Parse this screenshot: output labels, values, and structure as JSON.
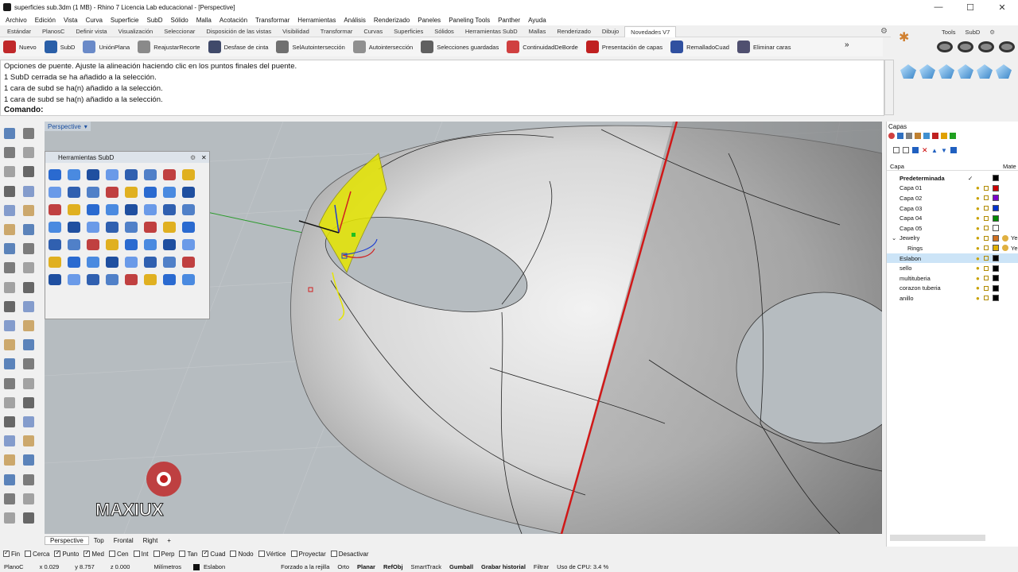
{
  "window": {
    "title": "superficies sub.3dm (1 MB) - Rhino 7 Licencia Lab educacional - [Perspective]"
  },
  "menu": [
    "Archivo",
    "Edición",
    "Vista",
    "Curva",
    "Superficie",
    "SubD",
    "Sólido",
    "Malla",
    "Acotación",
    "Transformar",
    "Herramientas",
    "Análisis",
    "Renderizado",
    "Paneles",
    "Paneling Tools",
    "Panther",
    "Ayuda"
  ],
  "tabs": [
    "Estándar",
    "PlanosC",
    "Definir vista",
    "Visualización",
    "Seleccionar",
    "Disposición de las vistas",
    "Visibilidad",
    "Transformar",
    "Curvas",
    "Superficies",
    "Sólidos",
    "Herramientas SubD",
    "Mallas",
    "Renderizado",
    "Dibujo",
    "Novedades V7"
  ],
  "toolbar": [
    {
      "label": "Nuevo",
      "color": "#c0282a"
    },
    {
      "label": "SubD",
      "color": "#2a5fa8"
    },
    {
      "label": "UniónPlana",
      "color": "#6a8ac8"
    },
    {
      "label": "ReajustarRecorte",
      "color": "#8a8a8a"
    },
    {
      "label": "Desfase de cinta",
      "color": "#404a6a"
    },
    {
      "label": "SelAutointersección",
      "color": "#707070"
    },
    {
      "label": "Autointersección",
      "color": "#909090"
    },
    {
      "label": "Selecciones guardadas",
      "color": "#606060"
    },
    {
      "label": "ContinuidadDeBorde",
      "color": "#d04040"
    },
    {
      "label": "Presentación de capas",
      "color": "#c02020"
    },
    {
      "label": "RemalladoCuad",
      "color": "#3050a0"
    },
    {
      "label": "Eliminar caras",
      "color": "#505070"
    }
  ],
  "right_tabs": [
    "Tools",
    "SubD"
  ],
  "command_history": [
    "Opciones de puente. Ajuste la alineación haciendo clic en los puntos finales del puente.",
    "1 SubD cerrada se ha añadido a la selección.",
    "1 cara de subd se ha(n) añadido a la selección.",
    "1 cara de subd se ha(n) añadido a la selección."
  ],
  "command_prompt": "Comando:",
  "viewport": {
    "label": "Perspective"
  },
  "subd_panel": {
    "title": "Herramientas SubD"
  },
  "watermark": {
    "text": "MAXIUX"
  },
  "viewport_tabs": [
    "Perspective",
    "Top",
    "Frontal",
    "Right"
  ],
  "osnaps": [
    {
      "label": "Fin",
      "on": true
    },
    {
      "label": "Cerca",
      "on": false
    },
    {
      "label": "Punto",
      "on": true
    },
    {
      "label": "Med",
      "on": true
    },
    {
      "label": "Cen",
      "on": false
    },
    {
      "label": "Int",
      "on": false
    },
    {
      "label": "Perp",
      "on": false
    },
    {
      "label": "Tan",
      "on": false
    },
    {
      "label": "Cuad",
      "on": true
    },
    {
      "label": "Nodo",
      "on": false
    },
    {
      "label": "Vértice",
      "on": false
    },
    {
      "label": "Proyectar",
      "on": false
    },
    {
      "label": "Desactivar",
      "on": false
    }
  ],
  "status": {
    "plane": "PlanoC",
    "x": "x 0.029",
    "y": "y 8.757",
    "z": "z 0.000",
    "units": "Milímetros",
    "layer": "Eslabon",
    "grid_snap": "Forzado a la rejilla",
    "ortho": "Orto",
    "planar": "Planar",
    "osnap": "RefObj",
    "smarttrack": "SmartTrack",
    "gumball": "Gumball",
    "history": "Grabar historial",
    "filter": "Filtrar",
    "cpu": "Uso de CPU: 3.4 %"
  },
  "layers": {
    "title": "Capas",
    "col_name": "Capa",
    "col_mat": "Mate",
    "rows": [
      {
        "name": "Predeterminada",
        "color": "#000000",
        "bold": true
      },
      {
        "name": "Capa 01",
        "color": "#cc0000"
      },
      {
        "name": "Capa 02",
        "color": "#7a00cc"
      },
      {
        "name": "Capa 03",
        "color": "#0033cc"
      },
      {
        "name": "Capa 04",
        "color": "#008800"
      },
      {
        "name": "Capa 05",
        "color": "#ffffff"
      },
      {
        "name": "Jewelry",
        "color": "#d07020",
        "mat": "Ye"
      },
      {
        "name": "Rings",
        "color": "#e0b000",
        "mat": "Ye",
        "indent": true
      },
      {
        "name": "Eslabon",
        "color": "#000000",
        "selected": true
      },
      {
        "name": "sello",
        "color": "#000000"
      },
      {
        "name": "multituberia",
        "color": "#000000"
      },
      {
        "name": "corazon tuberia",
        "color": "#000000"
      },
      {
        "name": "anillo",
        "color": "#000000"
      }
    ]
  }
}
